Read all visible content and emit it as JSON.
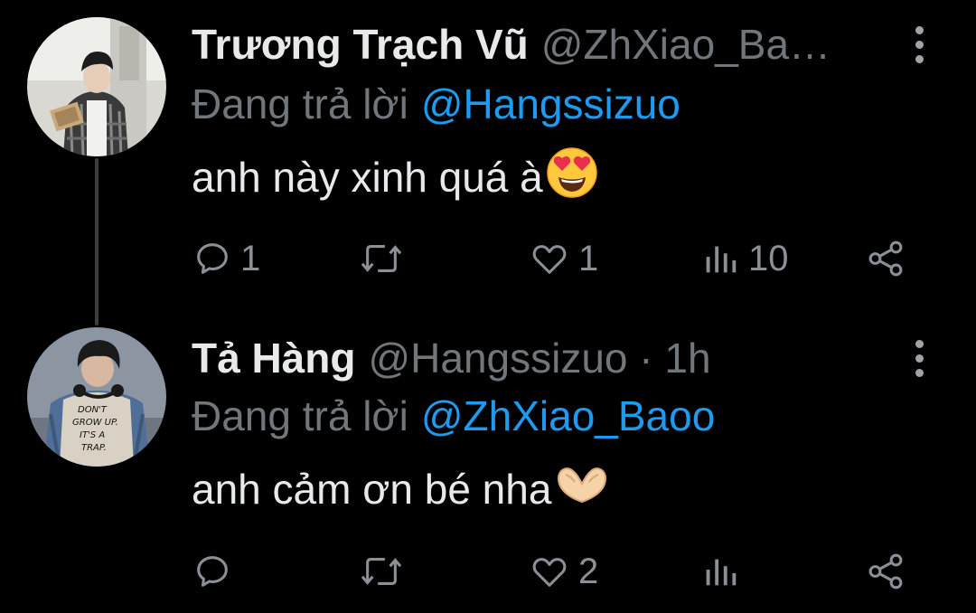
{
  "tweets": [
    {
      "display_name": "Trương Trạch Vũ",
      "handle": "@ZhXiao_Ba…",
      "reply_prefix": "Đang trả lời",
      "reply_to": "@Hangssizuo",
      "text": "anh này xinh quá à",
      "emoji": "smiling-face-with-heart-eyes",
      "actions": {
        "reply_count": "1",
        "retweet_count": "",
        "like_count": "1",
        "views_count": "10"
      }
    },
    {
      "display_name": "Tả Hàng",
      "handle": "@Hangssizuo · 1h",
      "reply_prefix": "Đang trả lời",
      "reply_to": "@ZhXiao_Baoo",
      "text": "anh cảm ơn bé nha",
      "emoji": "heart-hands",
      "shirt_text": [
        "DON'T",
        "GROW UP.",
        "IT'S A",
        "TRAP."
      ],
      "actions": {
        "reply_count": "",
        "retweet_count": "",
        "like_count": "2",
        "views_count": ""
      }
    }
  ],
  "colors": {
    "background": "#000000",
    "primary_text": "#e7e9ea",
    "secondary_text": "#71767b",
    "link": "#1d9bf0",
    "thread_line": "#3a3e42"
  }
}
